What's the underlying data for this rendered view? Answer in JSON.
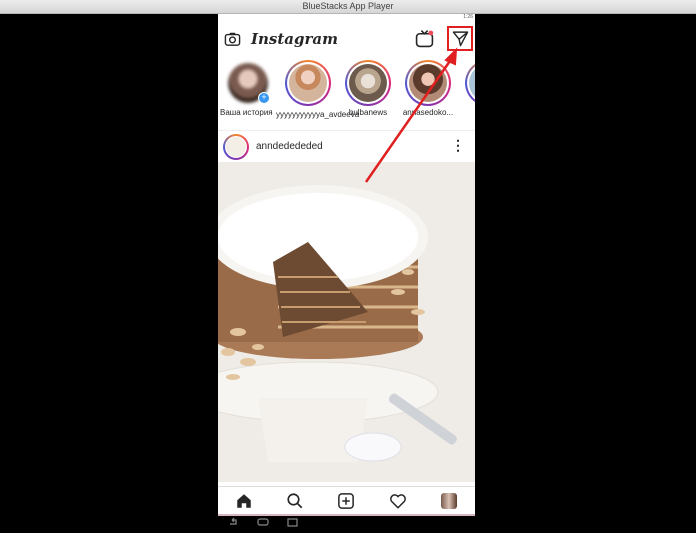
{
  "window": {
    "title": "BlueStacks App Player"
  },
  "status": {
    "time": "1:26"
  },
  "header": {
    "logo_text": "Instagram",
    "icons": [
      "camera-icon",
      "igtv-icon",
      "direct-message-icon"
    ]
  },
  "stories": [
    {
      "label": "Ваша история",
      "is_own": true
    },
    {
      "label": "yyyyyyyyyyya_avdeeva"
    },
    {
      "label": "bulbanews"
    },
    {
      "label": "annasedoko..."
    },
    {
      "label": ""
    }
  ],
  "post": {
    "username": "anndedededed",
    "more_label": "⋮"
  },
  "bottom_nav": [
    "home-icon",
    "search-icon",
    "new-post-icon",
    "activity-icon",
    "profile-icon"
  ],
  "colors": {
    "highlight": "#e02020",
    "accent_blue": "#3897f0"
  }
}
